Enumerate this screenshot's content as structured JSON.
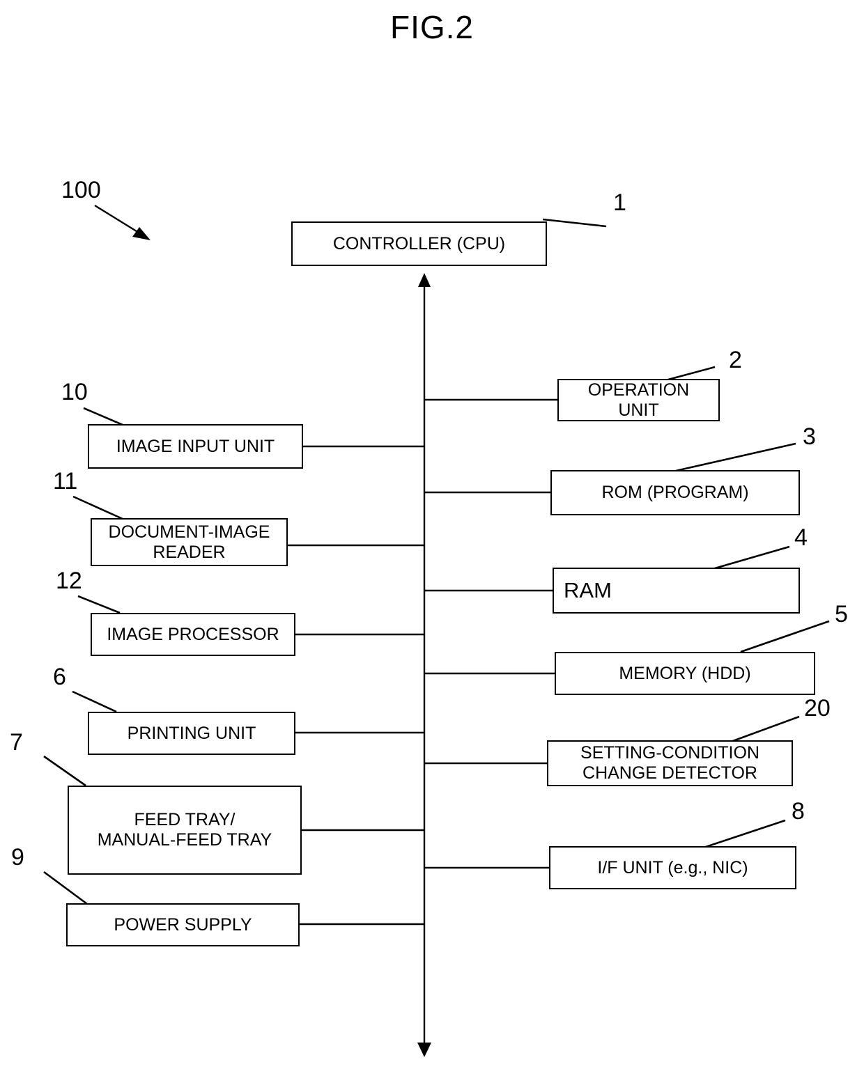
{
  "figure": {
    "title": "FIG.2",
    "system_ref": "100"
  },
  "nodes": [
    {
      "id": "controller",
      "label": "CONTROLLER (CPU)",
      "ref": "1"
    },
    {
      "id": "operation",
      "label": "OPERATION\nUNIT",
      "ref": "2"
    },
    {
      "id": "rom",
      "label": "ROM (PROGRAM)",
      "ref": "3"
    },
    {
      "id": "ram",
      "label": "RAM",
      "ref": "4"
    },
    {
      "id": "memory",
      "label": "MEMORY (HDD)",
      "ref": "5"
    },
    {
      "id": "detector",
      "label": "SETTING-CONDITION\nCHANGE DETECTOR",
      "ref": "20"
    },
    {
      "id": "ifunit",
      "label": "I/F UNIT (e.g., NIC)",
      "ref": "8"
    },
    {
      "id": "imageinput",
      "label": "IMAGE INPUT UNIT",
      "ref": "10"
    },
    {
      "id": "docreader",
      "label": "DOCUMENT-IMAGE\nREADER",
      "ref": "11"
    },
    {
      "id": "imageproc",
      "label": "IMAGE PROCESSOR",
      "ref": "12"
    },
    {
      "id": "printing",
      "label": "PRINTING UNIT",
      "ref": "6"
    },
    {
      "id": "feedtray",
      "label": "FEED TRAY/\nMANUAL-FEED TRAY",
      "ref": "7"
    },
    {
      "id": "power",
      "label": "POWER SUPPLY",
      "ref": "9"
    }
  ],
  "colors": {
    "line": "#000000",
    "background": "#ffffff"
  }
}
